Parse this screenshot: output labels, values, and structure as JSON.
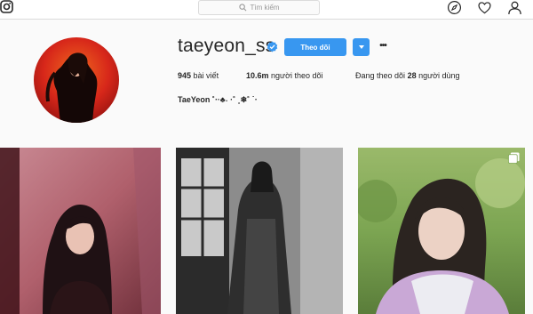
{
  "nav": {
    "search_placeholder": "Tìm kiếm",
    "icons": [
      "instagram-logo-icon",
      "search-icon",
      "compass-icon",
      "heart-icon",
      "user-icon"
    ]
  },
  "profile": {
    "username": "taeyeon_ss",
    "verified": true,
    "follow_label": "Theo dõi",
    "more_label": "•••",
    "stats": {
      "posts_count": "945",
      "posts_label": "bài viết",
      "followers_count": "10.6m",
      "followers_label": "người theo dõi",
      "following_prefix": "Đang theo dõi",
      "following_count": "28",
      "following_label": "người dùng"
    },
    "full_name": "TaeYeon ˚‧·♣︎˖ ·˚ ˳❄︎˚ ˙‧"
  },
  "colors": {
    "accent": "#3897f0",
    "background": "#fafafa",
    "text": "#262626"
  },
  "posts": [
    {
      "type": "photo",
      "multi": false
    },
    {
      "type": "photo",
      "multi": false
    },
    {
      "type": "photo",
      "multi": true
    }
  ]
}
